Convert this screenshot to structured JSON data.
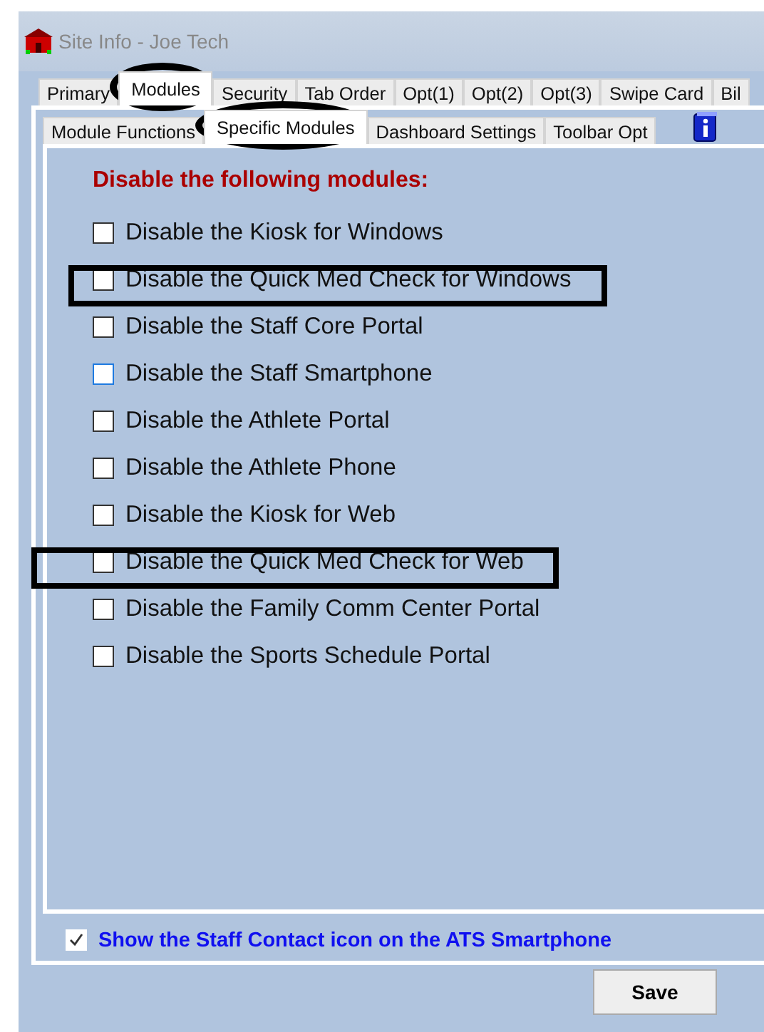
{
  "window": {
    "title": "Site Info - Joe Tech"
  },
  "tabs": [
    {
      "label": "Primary",
      "selected": false,
      "highlighted": false
    },
    {
      "label": "Modules",
      "selected": true,
      "highlighted": true
    },
    {
      "label": "Security",
      "selected": false,
      "highlighted": false
    },
    {
      "label": "Tab Order",
      "selected": false,
      "highlighted": false
    },
    {
      "label": "Opt(1)",
      "selected": false,
      "highlighted": false
    },
    {
      "label": "Opt(2)",
      "selected": false,
      "highlighted": false
    },
    {
      "label": "Opt(3)",
      "selected": false,
      "highlighted": false
    },
    {
      "label": "Swipe Card",
      "selected": false,
      "highlighted": false
    },
    {
      "label": "Bil",
      "selected": false,
      "highlighted": false
    }
  ],
  "subtabs": [
    {
      "label": "Module Functions",
      "selected": false,
      "highlighted": false
    },
    {
      "label": "Specific Modules",
      "selected": true,
      "highlighted": true
    },
    {
      "label": "Dashboard Settings",
      "selected": false,
      "highlighted": false
    },
    {
      "label": "Toolbar Opt",
      "selected": false,
      "highlighted": false
    }
  ],
  "heading": "Disable the following modules:",
  "modules": [
    {
      "label": "Disable the Kiosk for Windows",
      "checked": false,
      "focused": false,
      "highlighted": false
    },
    {
      "label": "Disable the Quick Med Check for Windows",
      "checked": false,
      "focused": false,
      "highlighted": true
    },
    {
      "label": "Disable the Staff Core Portal",
      "checked": false,
      "focused": false,
      "highlighted": false
    },
    {
      "label": "Disable the Staff Smartphone",
      "checked": false,
      "focused": true,
      "highlighted": false
    },
    {
      "label": "Disable the Athlete Portal",
      "checked": false,
      "focused": false,
      "highlighted": false
    },
    {
      "label": "Disable the Athlete Phone",
      "checked": false,
      "focused": false,
      "highlighted": false
    },
    {
      "label": "Disable the Kiosk for Web",
      "checked": false,
      "focused": false,
      "highlighted": false
    },
    {
      "label": "Disable the Quick Med Check for Web",
      "checked": false,
      "focused": false,
      "highlighted": true
    },
    {
      "label": "Disable the Family Comm Center Portal",
      "checked": false,
      "focused": false,
      "highlighted": false
    },
    {
      "label": "Disable the Sports Schedule Portal",
      "checked": false,
      "focused": false,
      "highlighted": false
    }
  ],
  "staff_contact": {
    "label": "Show the Staff Contact icon on the ATS Smartphone",
    "checked": true
  },
  "buttons": [
    "Save"
  ]
}
